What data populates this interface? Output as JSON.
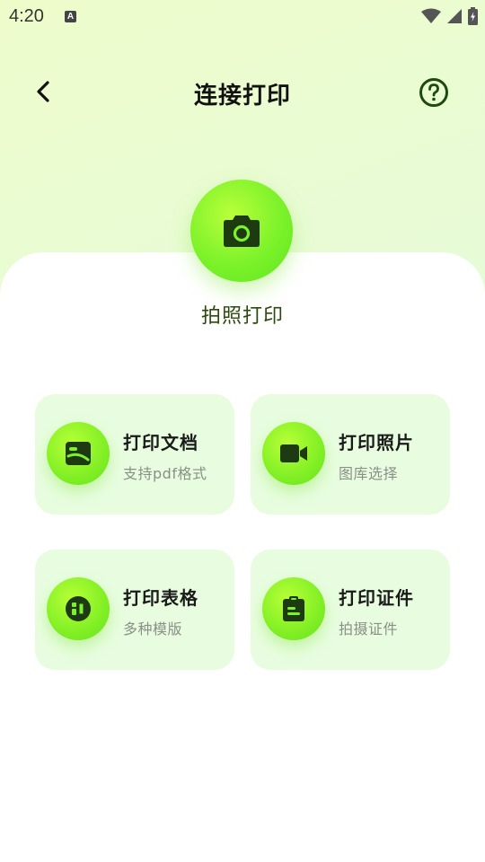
{
  "status": {
    "time": "4:20",
    "badge": "A"
  },
  "header": {
    "title": "连接打印"
  },
  "hero": {
    "label": "拍照打印",
    "icon": "camera-icon"
  },
  "cards": [
    {
      "title": "打印文档",
      "subtitle": "支持pdf格式",
      "icon": "document-icon"
    },
    {
      "title": "打印照片",
      "subtitle": "图库选择",
      "icon": "video-camera-icon"
    },
    {
      "title": "打印表格",
      "subtitle": "多种模版",
      "icon": "table-icon"
    },
    {
      "title": "打印证件",
      "subtitle": "拍摄证件",
      "icon": "clipboard-icon"
    }
  ],
  "colors": {
    "accent": "#7cf22a",
    "icon_dark": "#1e3a12",
    "card_bg": "#e8fde0"
  }
}
